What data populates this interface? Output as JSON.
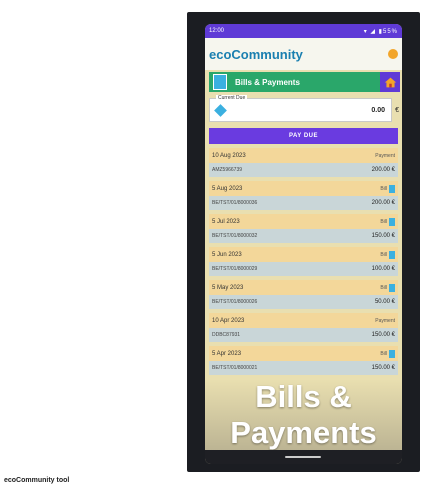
{
  "status": {
    "time": "12:00",
    "right": "▾ ◢ ▮55%"
  },
  "header": {
    "logo": "ecoCommunity",
    "logo_sub": ""
  },
  "title_bar": {
    "title": "Bills & Payments"
  },
  "due": {
    "label": "Current Due",
    "value": "0.00",
    "currency": "€"
  },
  "pay_button": {
    "label": "PAY DUE"
  },
  "entries": [
    {
      "date": "10 Aug 2023",
      "type": "Payment",
      "ref": "AMZ5966739",
      "amount": "200.00 €"
    },
    {
      "date": "5 Aug 2023",
      "type": "Bill",
      "ref": "BE/TST/01/8000036",
      "amount": "200.00 €"
    },
    {
      "date": "5 Jul 2023",
      "type": "Bill",
      "ref": "BE/TST/01/8000032",
      "amount": "150.00 €"
    },
    {
      "date": "5 Jun 2023",
      "type": "Bill",
      "ref": "BE/TST/01/8000029",
      "amount": "100.00 €"
    },
    {
      "date": "5 May 2023",
      "type": "Bill",
      "ref": "BE/TST/01/8000026",
      "amount": "50.00 €"
    },
    {
      "date": "10 Apr 2023",
      "type": "Payment",
      "ref": "DDBC87931",
      "amount": "150.00 €"
    },
    {
      "date": "5 Apr 2023",
      "type": "Bill",
      "ref": "BE/TST/01/8000021",
      "amount": "150.00 €"
    }
  ],
  "overlay": {
    "line1": "Bills &",
    "line2": "Payments"
  },
  "caption": "ecoCommunity tool",
  "colors": {
    "accent": "#5f3ad6",
    "green": "#2aa76a",
    "bill_blue": "#3bb0e0"
  }
}
